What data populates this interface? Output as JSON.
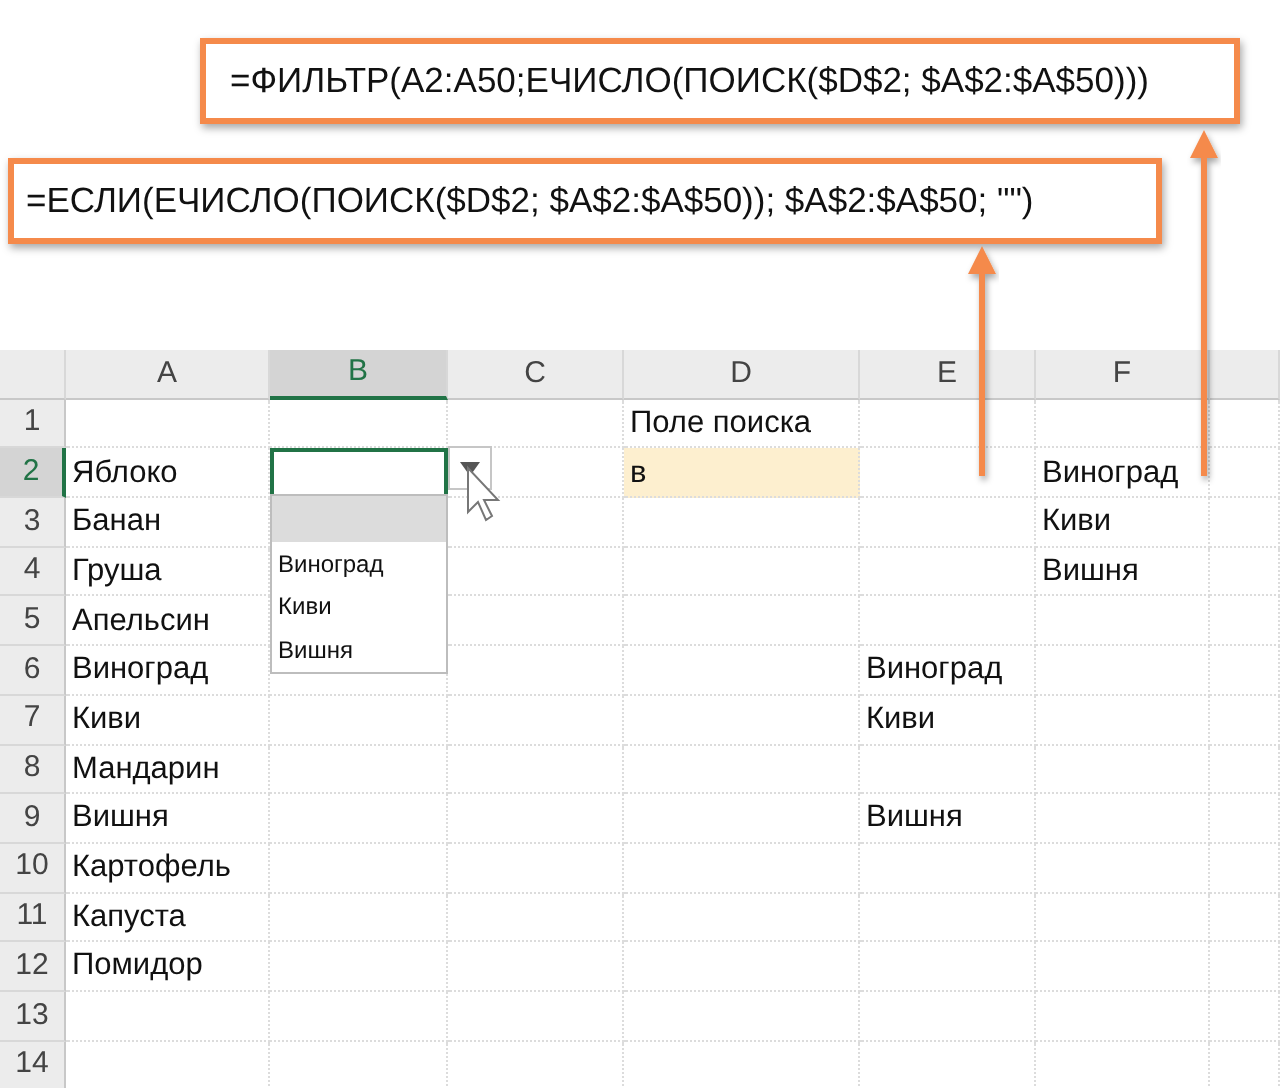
{
  "formulas": [
    {
      "text": "=ФИЛЬТР(A2:A50;ЕЧИСЛО(ПОИСК($D$2; $A$2:$A$50)))"
    },
    {
      "text": "=ЕСЛИ(ЕЧИСЛО(ПОИСК($D$2; $A$2:$A$50)); $A$2:$A$50; \"\")"
    }
  ],
  "columns": [
    {
      "label": "A",
      "selected": false
    },
    {
      "label": "B",
      "selected": true
    },
    {
      "label": "C",
      "selected": false
    },
    {
      "label": "D",
      "selected": false
    },
    {
      "label": "E",
      "selected": false
    },
    {
      "label": "F",
      "selected": false
    }
  ],
  "rows": [
    {
      "number": "1",
      "selected": false,
      "cells": {
        "D": {
          "text": "Поле поиска",
          "highlighted": false
        }
      }
    },
    {
      "number": "2",
      "selected": true,
      "cells": {
        "A": {
          "text": "Яблоко",
          "highlighted": false
        },
        "D": {
          "text": "в",
          "highlighted": true
        },
        "F": {
          "text": "Виноград",
          "highlighted": false
        }
      }
    },
    {
      "number": "3",
      "selected": false,
      "cells": {
        "A": {
          "text": "Банан",
          "highlighted": false
        },
        "F": {
          "text": "Киви",
          "highlighted": false
        }
      }
    },
    {
      "number": "4",
      "selected": false,
      "cells": {
        "A": {
          "text": "Груша",
          "highlighted": false
        },
        "F": {
          "text": "Вишня",
          "highlighted": false
        }
      }
    },
    {
      "number": "5",
      "selected": false,
      "cells": {
        "A": {
          "text": "Апельсин",
          "highlighted": false
        }
      }
    },
    {
      "number": "6",
      "selected": false,
      "cells": {
        "A": {
          "text": "Виноград",
          "highlighted": false
        },
        "E": {
          "text": "Виноград",
          "highlighted": false
        }
      }
    },
    {
      "number": "7",
      "selected": false,
      "cells": {
        "A": {
          "text": "Киви",
          "highlighted": false
        },
        "E": {
          "text": "Киви",
          "highlighted": false
        }
      }
    },
    {
      "number": "8",
      "selected": false,
      "cells": {
        "A": {
          "text": "Мандарин",
          "highlighted": false
        }
      }
    },
    {
      "number": "9",
      "selected": false,
      "cells": {
        "A": {
          "text": "Вишня",
          "highlighted": false
        },
        "E": {
          "text": "Вишня",
          "highlighted": false
        }
      }
    },
    {
      "number": "10",
      "selected": false,
      "cells": {
        "A": {
          "text": "Картофель",
          "highlighted": false
        }
      }
    },
    {
      "number": "11",
      "selected": false,
      "cells": {
        "A": {
          "text": "Капуста",
          "highlighted": false
        }
      }
    },
    {
      "number": "12",
      "selected": false,
      "cells": {
        "A": {
          "text": "Помидор",
          "highlighted": false
        }
      }
    },
    {
      "number": "13",
      "selected": false
    },
    {
      "number": "14",
      "selected": false
    }
  ],
  "dropdown": {
    "open": true,
    "blank_row_highlighted": true,
    "items": [
      {
        "text": "Виноград"
      },
      {
        "text": "Киви"
      },
      {
        "text": "Вишня"
      }
    ]
  }
}
